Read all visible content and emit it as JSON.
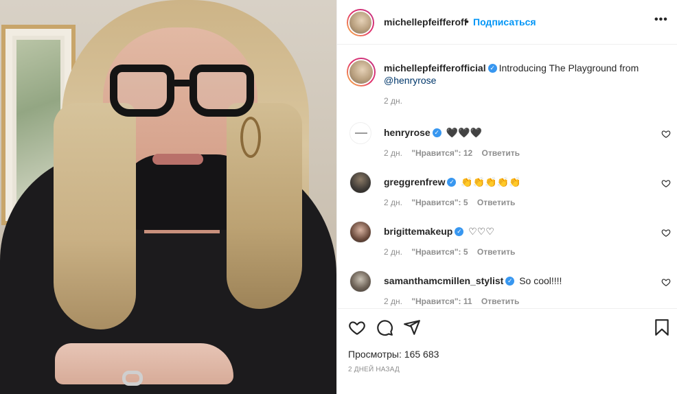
{
  "post": {
    "author": "michellepfeifferoff",
    "separator": "•",
    "follow_label": "Подписаться",
    "more_label": "•••"
  },
  "caption": {
    "author": "michellepfeifferofficial",
    "verified_icon": "verified-badge-icon",
    "text": "Introducing The Playground from",
    "mention": "@henryrose",
    "time": "2 дн."
  },
  "comments": [
    {
      "author": "henryrose",
      "verified": true,
      "text": "🖤🖤🖤",
      "time": "2 дн.",
      "likes": "\"Нравится\": 12",
      "reply": "Ответить"
    },
    {
      "author": "greggrenfrew",
      "verified": true,
      "text": "👏👏👏👏👏",
      "time": "2 дн.",
      "likes": "\"Нравится\": 5",
      "reply": "Ответить"
    },
    {
      "author": "brigittemakeup",
      "verified": true,
      "text": "♡♡♡",
      "time": "2 дн.",
      "likes": "\"Нравится\": 5",
      "reply": "Ответить"
    },
    {
      "author": "samanthamcmillen_stylist",
      "verified": true,
      "text": "So cool!!!!",
      "time": "2 дн.",
      "likes": "\"Нравится\": 11",
      "reply": "Ответить"
    }
  ],
  "actions": {
    "icons": [
      "heart-icon",
      "comment-icon",
      "share-icon",
      "bookmark-icon"
    ],
    "views": "Просмотры: 165 683",
    "date": "2 ДНЕЙ НАЗАД"
  },
  "colors": {
    "link": "#0095f6",
    "verified": "#3897f0",
    "meta": "#8e8e8e"
  }
}
